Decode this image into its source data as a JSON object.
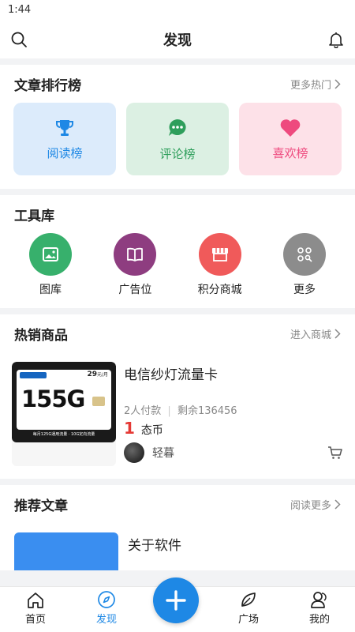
{
  "status": {
    "time": "1:44"
  },
  "header": {
    "title": "发现"
  },
  "ranking": {
    "title": "文章排行榜",
    "more": "更多热门",
    "cards": [
      {
        "label": "阅读榜",
        "icon": "trophy-icon",
        "color": "#1e88e5",
        "bg": "#dcebfb"
      },
      {
        "label": "评论榜",
        "icon": "comment-icon",
        "color": "#2e9e5b",
        "bg": "#dcf0e3"
      },
      {
        "label": "喜欢榜",
        "icon": "heart-icon",
        "color": "#ee4a7e",
        "bg": "#fde1e8"
      }
    ]
  },
  "tools": {
    "title": "工具库",
    "items": [
      {
        "label": "图库",
        "icon": "gallery-icon",
        "color": "#37b06c"
      },
      {
        "label": "广告位",
        "icon": "book-icon",
        "color": "#8e3d80"
      },
      {
        "label": "积分商城",
        "icon": "shop-icon",
        "color": "#f05a5a"
      },
      {
        "label": "更多",
        "icon": "more-apps-icon",
        "color": "#8c8c8c"
      }
    ]
  },
  "hot_products": {
    "title": "热销商品",
    "more": "进入商城",
    "items": [
      {
        "title": "电信纱灯流量卡",
        "sold": "2人付款",
        "remaining": "剩余136456",
        "price": "1",
        "price_unit": "态币",
        "seller": "轻暮",
        "image_text": {
          "big": "155G",
          "price_tag": "29",
          "price_tag_unit": "元/月",
          "footer": "每月125G通用流量 · 10G定向流量"
        }
      }
    ]
  },
  "articles": {
    "title": "推荐文章",
    "more": "阅读更多",
    "items": [
      {
        "title": "关于软件"
      }
    ]
  },
  "tabbar": {
    "items": [
      {
        "label": "首页",
        "icon": "home-icon"
      },
      {
        "label": "发现",
        "icon": "compass-icon",
        "active": true
      },
      {
        "label": "广场",
        "icon": "leaf-icon"
      },
      {
        "label": "我的",
        "icon": "user-icon"
      }
    ]
  }
}
